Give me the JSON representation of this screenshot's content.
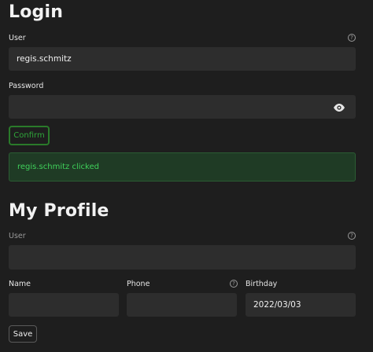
{
  "login": {
    "title": "Login",
    "user_label": "User",
    "user_value": "regis.schmitz",
    "password_label": "Password",
    "password_value": "",
    "confirm_label": "Confirm",
    "message": "regis.schmitz clicked",
    "help_glyph": "?"
  },
  "profile": {
    "title": "My Profile",
    "user_label": "User",
    "user_value": "",
    "name_label": "Name",
    "name_value": "",
    "phone_label": "Phone",
    "phone_value": "",
    "birthday_label": "Birthday",
    "birthday_value": "2022/03/03",
    "save_label": "Save",
    "help_glyph": "?"
  },
  "colors": {
    "background": "#1e1e1e",
    "field": "#2d2d2d",
    "accent_green": "#2fa63a",
    "success_bg": "#1f3b25"
  },
  "icons": [
    "help-icon",
    "eye-icon"
  ]
}
